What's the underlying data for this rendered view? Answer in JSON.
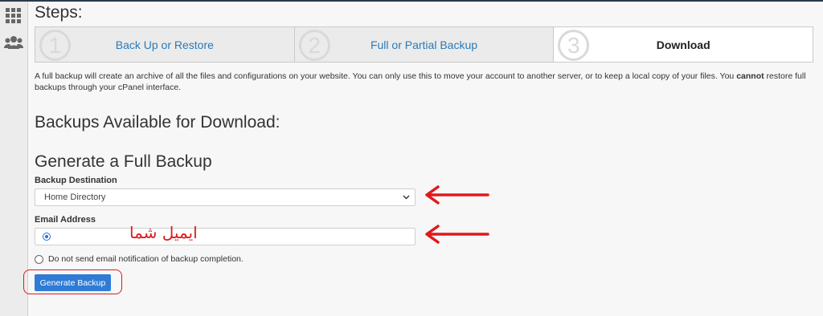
{
  "sidebar": {
    "icons": [
      "grid-icon",
      "users-icon"
    ]
  },
  "steps": {
    "title": "Steps:",
    "items": [
      {
        "number": "1",
        "label": "Back Up or Restore",
        "active": false
      },
      {
        "number": "2",
        "label": "Full or Partial Backup",
        "active": false
      },
      {
        "number": "3",
        "label": "Download",
        "active": true
      }
    ]
  },
  "description": {
    "part1": "A full backup will create an archive of all the files and configurations on your website. You can only use this to move your account to another server, or to keep a local copy of your files. You ",
    "emphasis": "cannot",
    "part2": " restore full backups through your cPanel interface."
  },
  "backups_available": {
    "heading": "Backups Available for Download:"
  },
  "generate": {
    "heading": "Generate a Full Backup",
    "destination_label": "Backup Destination",
    "destination_value": "Home Directory",
    "email_label": "Email Address",
    "email_value": "",
    "email_annotation": "ایمیل شما",
    "no_email_label": "Do not send email notification of backup completion.",
    "button_label": "Generate Backup"
  },
  "colors": {
    "accent": "#2f7bd5",
    "annotation": "#e0191b",
    "step_link": "#2a7ab8"
  }
}
